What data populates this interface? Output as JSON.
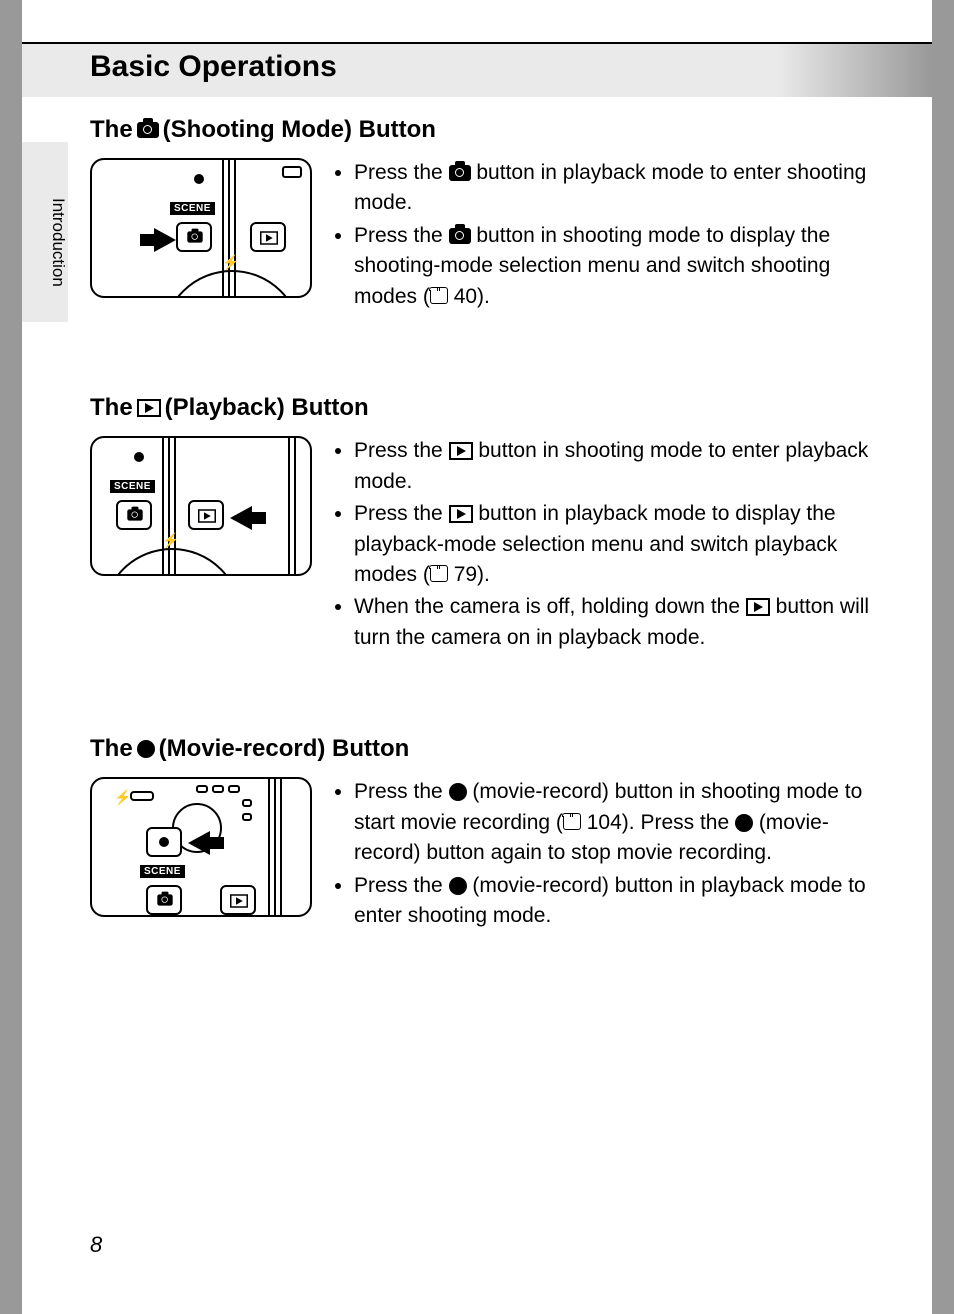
{
  "side_tab": "Introduction",
  "page_title": "Basic Operations",
  "page_number": "8",
  "sections": {
    "shooting": {
      "title_pre": "The",
      "title_post": "(Shooting Mode) Button",
      "b1a": "Press the ",
      "b1b": " button in playback mode to enter shooting mode.",
      "b2a": "Press the ",
      "b2b": " button in shooting mode to display the shooting-mode selection menu and switch shooting modes (",
      "b2c": " 40)."
    },
    "playback": {
      "title_pre": "The",
      "title_post": "(Playback) Button",
      "b1a": "Press the ",
      "b1b": " button in shooting mode to enter playback mode.",
      "b2a": "Press the ",
      "b2b": " button in playback mode to display the playback-mode selection menu and switch playback modes (",
      "b2c": " 79).",
      "b3a": "When the camera is off, holding down the ",
      "b3b": " button will turn the camera on in playback mode."
    },
    "movie": {
      "title_pre": "The",
      "title_post": "(Movie-record) Button",
      "b1a": "Press the ",
      "b1b": " (movie-record) button in shooting mode to start movie recording (",
      "b1c": " 104). Press the ",
      "b1d": " (movie-record) button again to stop movie recording.",
      "b2a": "Press the ",
      "b2b": " (movie-record) button in playback mode to enter shooting mode."
    }
  },
  "scene_label": "SCENE"
}
